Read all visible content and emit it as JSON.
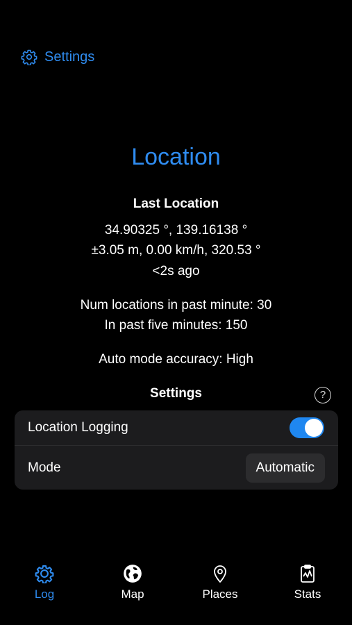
{
  "header": {
    "settings_label": "Settings",
    "settings_icon": "gear-icon"
  },
  "location": {
    "title": "Location",
    "last_location_heading": "Last Location",
    "coordinates": "34.90325 °, 139.16138 °",
    "accuracy_speed_course": "±3.05 m, 0.00 km/h, 320.53 °",
    "age": "<2s ago",
    "num_past_minute": "Num locations in past minute: 30",
    "num_past_five_minutes": "In past five minutes: 150",
    "auto_mode_accuracy": "Auto mode accuracy: High"
  },
  "settings_section": {
    "heading": "Settings",
    "help_symbol": "?",
    "location_logging_label": "Location Logging",
    "location_logging_enabled": true,
    "mode_label": "Mode",
    "mode_value": "Automatic"
  },
  "tab_bar": {
    "active_tab": "Log",
    "tabs": [
      {
        "label": "Log",
        "icon": "gear-icon"
      },
      {
        "label": "Map",
        "icon": "globe-icon"
      },
      {
        "label": "Places",
        "icon": "map-pin-icon"
      },
      {
        "label": "Stats",
        "icon": "clipboard-chart-icon"
      }
    ]
  },
  "colors": {
    "accent": "#2f8cf0",
    "toggle_on": "#1f87f0",
    "background": "#000000",
    "card": "#1c1c1e"
  }
}
